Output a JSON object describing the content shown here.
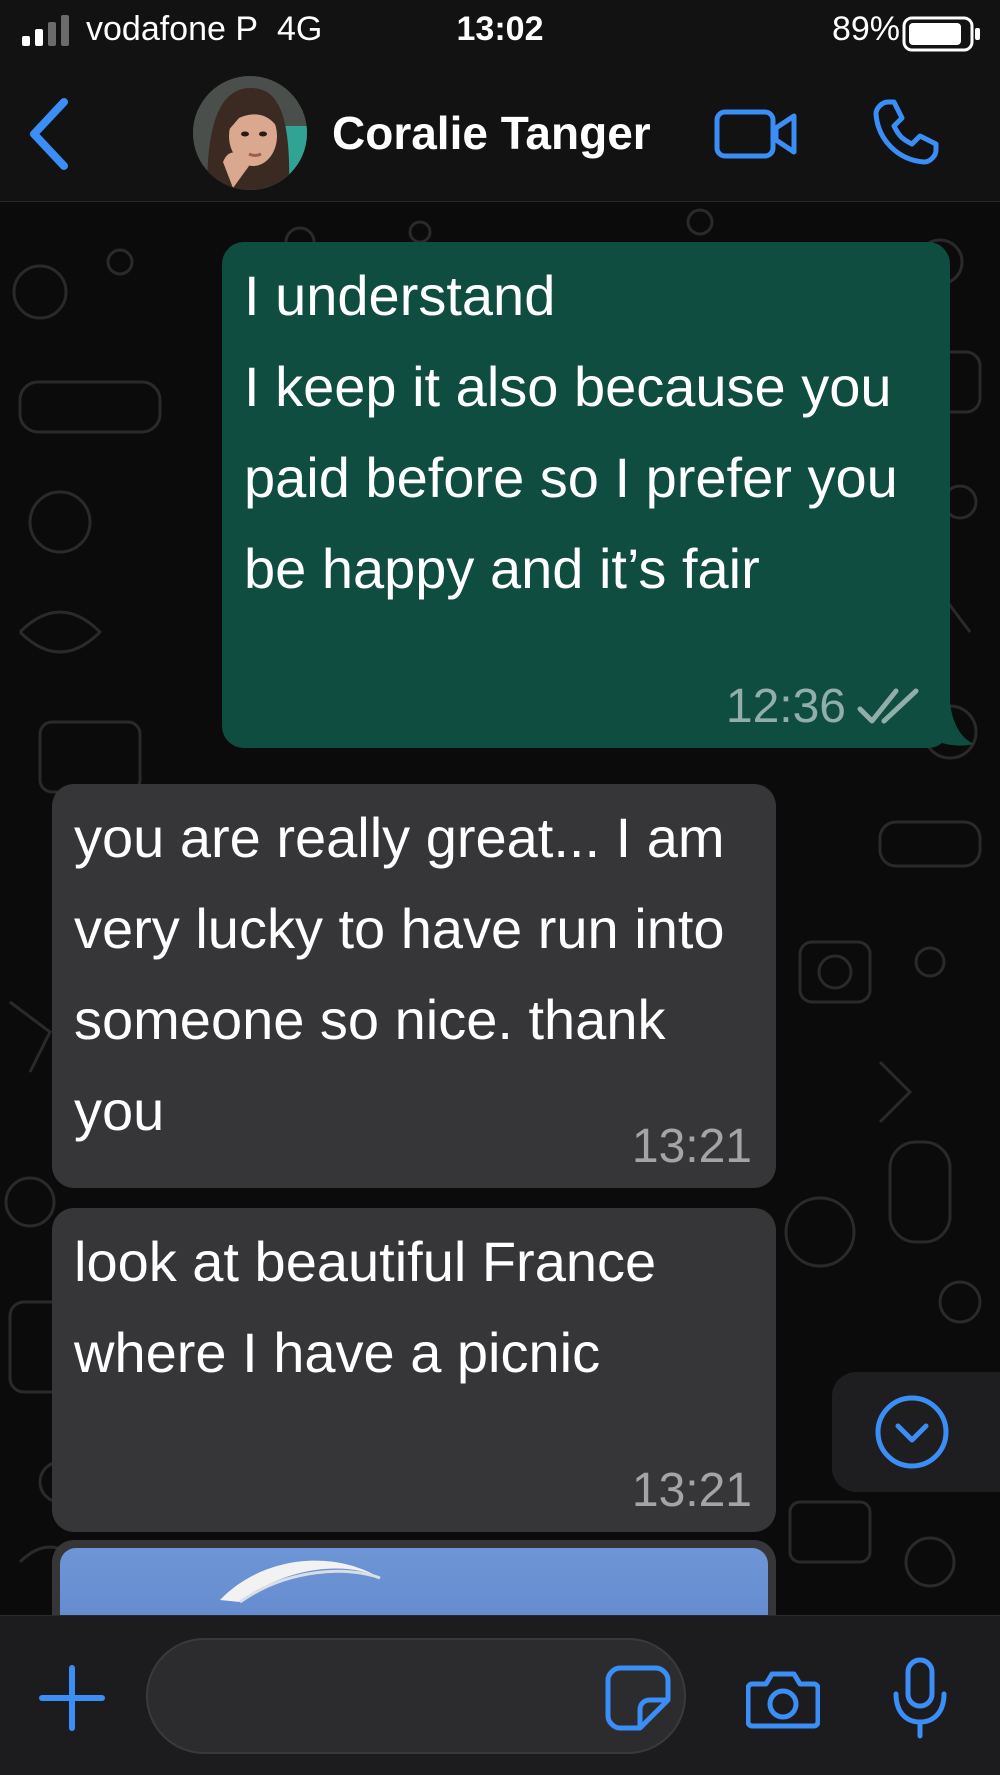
{
  "status_bar": {
    "carrier": "vodafone P",
    "network": "4G",
    "time": "13:02",
    "battery_percent": "89%",
    "battery_level": 0.89,
    "signal_bars_filled": 2,
    "signal_bars_total": 4
  },
  "header": {
    "contact_name": "Coralie Tanger",
    "icons": [
      "chevron-left-icon",
      "avatar",
      "video-camera-icon",
      "phone-icon"
    ]
  },
  "messages": [
    {
      "direction": "outgoing",
      "text": "I understand\nI keep it also because you paid before so I prefer you be happy and it’s fair",
      "time": "12:36",
      "status": "read"
    },
    {
      "direction": "incoming",
      "text": "you are really great... I am very lucky to have run into someone so nice. thank you",
      "time": "13:21"
    },
    {
      "direction": "incoming",
      "text": "look at beautiful France where I have a picnic",
      "time": "13:21"
    },
    {
      "direction": "incoming",
      "type": "image",
      "description": ""
    }
  ],
  "scroll_down_icon": "chevron-down-circle-icon",
  "input_bar": {
    "placeholder": "",
    "icons": [
      "plus-icon",
      "sticker-icon",
      "camera-icon",
      "microphone-icon"
    ]
  },
  "colors": {
    "accent": "#3a8ef6",
    "outgoing_bubble": "#0f4d40",
    "incoming_bubble": "#363638",
    "background": "#0b0b0b"
  }
}
